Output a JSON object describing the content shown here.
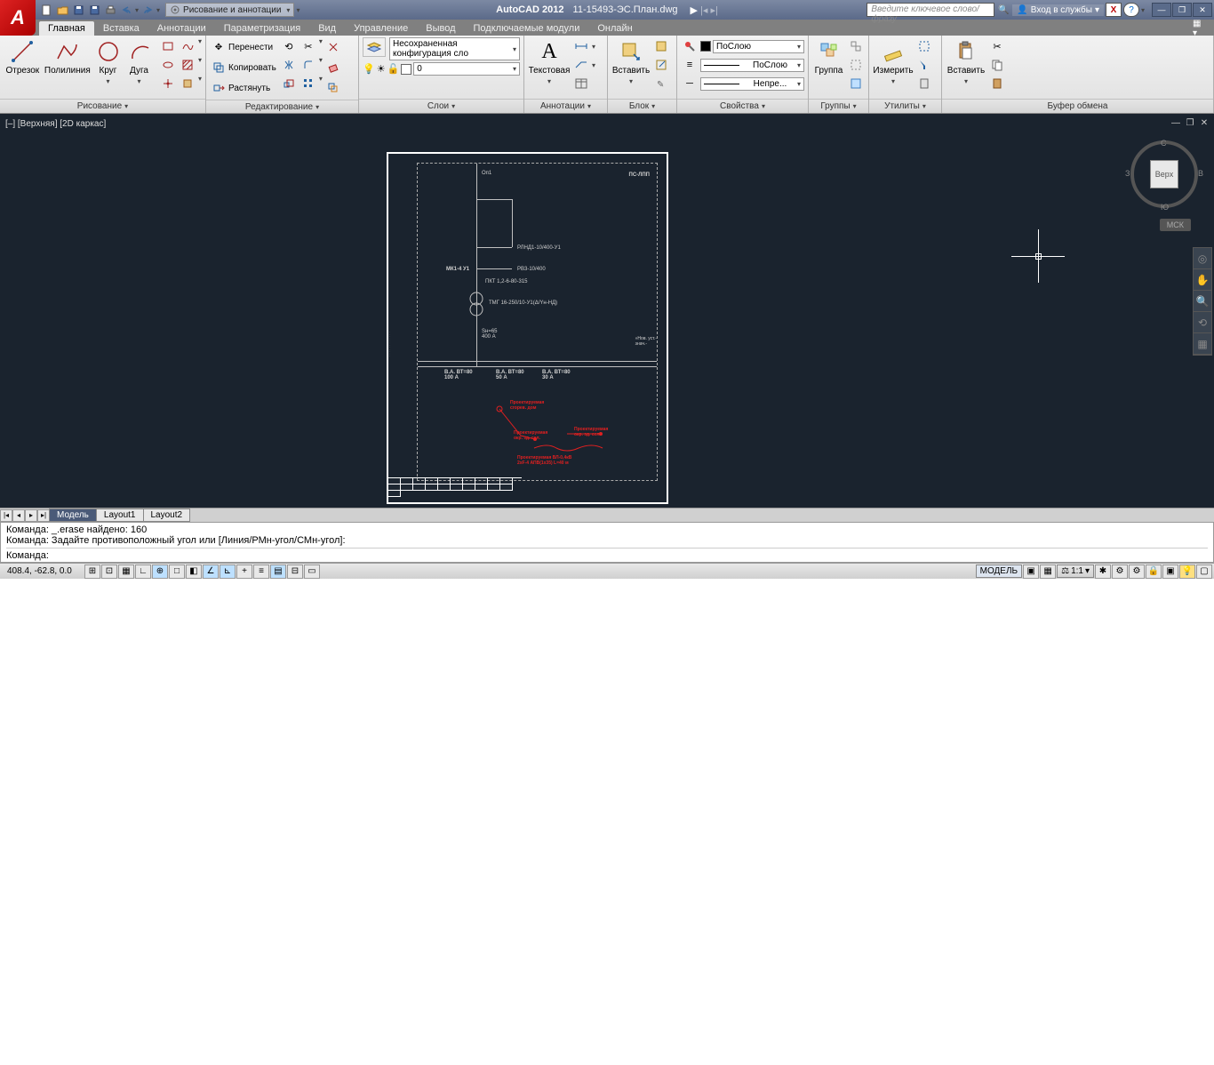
{
  "title": {
    "app": "AutoCAD 2012",
    "file": "11-15493-ЭС.План.dwg"
  },
  "qat_workspace": "Рисование и аннотации",
  "search_placeholder": "Введите ключевое слово/фразу",
  "sign_in": "Вход в службы",
  "tabs": [
    "Главная",
    "Вставка",
    "Аннотации",
    "Параметризация",
    "Вид",
    "Управление",
    "Вывод",
    "Подключаемые модули",
    "Онлайн"
  ],
  "active_tab": 0,
  "ribbon": {
    "draw": {
      "title": "Рисование",
      "line": "Отрезок",
      "polyline": "Полилиния",
      "circle": "Круг",
      "arc": "Дуга"
    },
    "edit": {
      "title": "Редактирование",
      "move": "Перенести",
      "copy": "Копировать",
      "stretch": "Растянуть"
    },
    "layers": {
      "title": "Слои",
      "config": "Несохраненная конфигурация сло",
      "layer_value": "0"
    },
    "annot": {
      "title": "Аннотации",
      "text": "Текстовая"
    },
    "block": {
      "title": "Блок",
      "insert": "Вставить"
    },
    "props": {
      "title": "Свойства",
      "color": "ПоСлою",
      "lineweight": "ПоСлою",
      "linetype": "Непре..."
    },
    "group": {
      "title": "Группы",
      "group": "Группа"
    },
    "util": {
      "title": "Утилиты",
      "measure": "Измерить"
    },
    "clip": {
      "title": "Буфер обмена",
      "paste": "Вставить"
    }
  },
  "view": {
    "label": "[–] [Верхняя] [2D каркас]",
    "cube_face": "Верх",
    "compass": {
      "n": "С",
      "e": "В",
      "s": "Ю",
      "w": "З"
    },
    "wcs": "МСК"
  },
  "drawing": {
    "header": "Oп1",
    "corner": "ПС-ЛПП",
    "line1": "РЛНД1-10/400-У1",
    "mk": "МК1-4 У1",
    "line2": "РВ3-10/400",
    "fuse": "ПКТ 1,2-6-80-315",
    "trans": "ТМГ 16-250/10-У1(Δ/Yн-НД)",
    "trans2": "Sн=65\n400 А",
    "side": "»Нов. уст.-\nзнач.-",
    "b1": "В.А. ВТ=80\n100 А",
    "b2": "В.А. ВТ=80\n50 А",
    "b3": "В.А. ВТ=80\n30 А",
    "red1": "Проектируемая\nокр. зд. сел.",
    "red2": "Проектируемая\nокр. зд. сел.",
    "red3": "Проектируемая\nсгорев. дом",
    "red4": "Проектируемая ВЛ-0,4кВ\n2хF-4 АПВ(1х35) L=40 м"
  },
  "layout_tabs": [
    "Модель",
    "Layout1",
    "Layout2"
  ],
  "active_layout": 0,
  "cmd": {
    "l1": "Команда: _.erase найдено: 160",
    "l2": "Команда: Задайте противоположный угол или [Линия/РМн-угол/СМн-угол]:",
    "prompt": "Команда:"
  },
  "status": {
    "coords": "408.4, -62.8, 0.0",
    "model": "МОДЕЛЬ",
    "scale": "1:1"
  }
}
